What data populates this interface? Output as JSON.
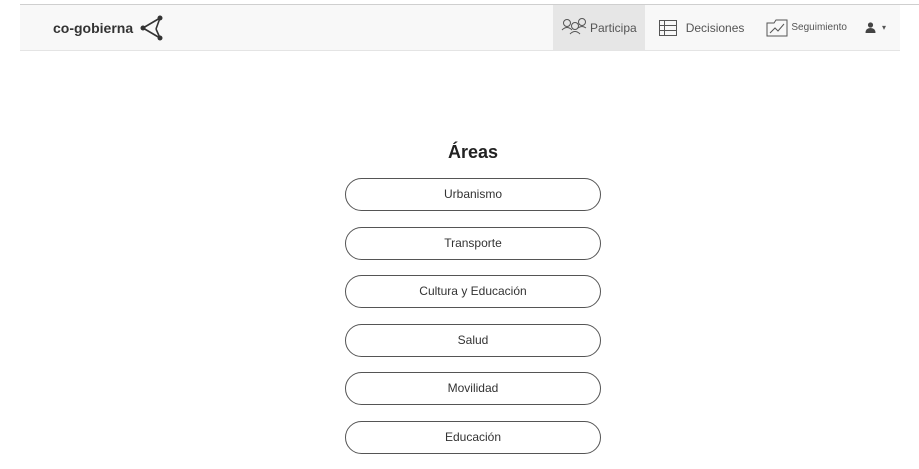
{
  "header": {
    "brand": "co-gobierna",
    "brand_icon": "network-share-icon",
    "nav": [
      {
        "label": "Participa",
        "icon": "people-group-icon",
        "active": true
      },
      {
        "label": "Decisiones",
        "icon": "list-icon",
        "active": false
      },
      {
        "label": "Seguimiento",
        "icon": "chart-folder-icon",
        "active": false
      }
    ],
    "user_menu": {
      "icon": "user-icon",
      "caret": "▾"
    }
  },
  "main": {
    "title": "Áreas",
    "areas": [
      "Urbanismo",
      "Transporte",
      "Cultura y Educación",
      "Salud",
      "Movilidad",
      "Educación"
    ]
  }
}
